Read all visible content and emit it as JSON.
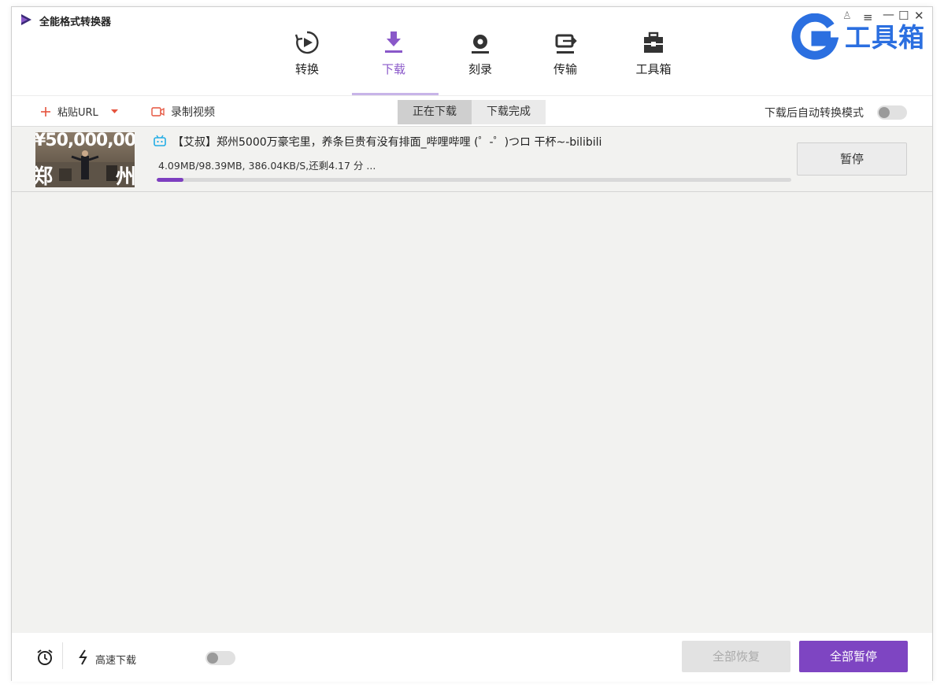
{
  "app": {
    "title": "全能格式转换器"
  },
  "nav": {
    "items": [
      {
        "label": "转换",
        "icon": "convert-icon"
      },
      {
        "label": "下载",
        "icon": "download-icon",
        "active": true
      },
      {
        "label": "刻录",
        "icon": "burn-disc-icon"
      },
      {
        "label": "传输",
        "icon": "transfer-icon"
      },
      {
        "label": "工具箱",
        "icon": "toolbox-icon"
      }
    ]
  },
  "window_controls": {
    "user": "♙",
    "menu": "≡",
    "minimize": "—",
    "maximize": "☐",
    "close": "✕"
  },
  "brand": {
    "letter": "G",
    "text": "工具箱",
    "color": "#2b6fe0"
  },
  "toolbar": {
    "paste_url": "粘贴URL",
    "record_video": "录制视频",
    "tab_downloading": "正在下载",
    "tab_finished": "下载完成",
    "auto_convert_label": "下载后自动转换模式"
  },
  "download": {
    "title": "【艾叔】郑州5000万豪宅里，养条巨贵有没有排面_哔哩哔哩 (゜-゜)つロ 干杯~-bilibili",
    "progress_text": "4.09MB/98.39MB, 386.04KB/S,还剩4.17 分 ...",
    "progress": 0.042,
    "pause_label": "暂停",
    "thumb_text_top": "¥50,000,00",
    "thumb_text_bottom": "郑",
    "thumb_text_right": "州"
  },
  "footer": {
    "high_speed_label": "高速下载",
    "resume_all": "全部恢复",
    "pause_all": "全部暂停"
  },
  "colors": {
    "accent": "#7e45c2",
    "progress": "#7d3fc0"
  }
}
